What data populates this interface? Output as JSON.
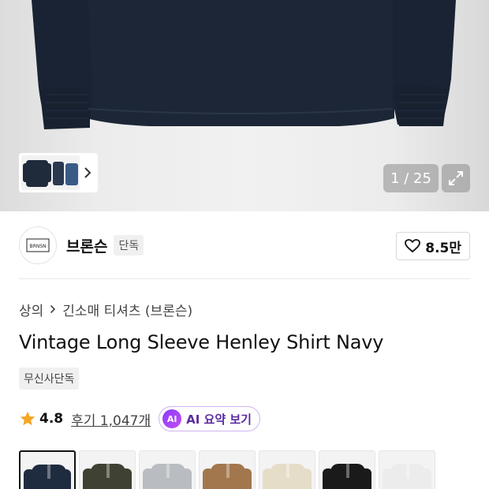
{
  "gallery": {
    "counter_text": "1 / 25"
  },
  "brand": {
    "name": "브론슨",
    "tag": "단독",
    "logo_text": "BRONSON"
  },
  "like": {
    "count": "8.5만"
  },
  "breadcrumb": {
    "category": "상의",
    "subcategory": "긴소매 티셔츠 (브론슨)"
  },
  "product": {
    "title": "Vintage Long Sleeve Henley Shirt Navy",
    "badge": "무신사단독"
  },
  "rating": {
    "score": "4.8",
    "reviews_label": "후기 1,047개",
    "star_color": "#f5a623"
  },
  "ai_summary": {
    "icon_text": "AI",
    "label": "AI 요약 보기"
  },
  "color_options": [
    {
      "name": "navy",
      "color": "#1f2c3f"
    },
    {
      "name": "olive",
      "color": "#3f4233"
    },
    {
      "name": "grey",
      "color": "#b9bcc0"
    },
    {
      "name": "brown",
      "color": "#a2774e"
    },
    {
      "name": "cream",
      "color": "#e6ddc8"
    },
    {
      "name": "black",
      "color": "#1a1a1a"
    },
    {
      "name": "white",
      "color": "#ececec"
    }
  ]
}
